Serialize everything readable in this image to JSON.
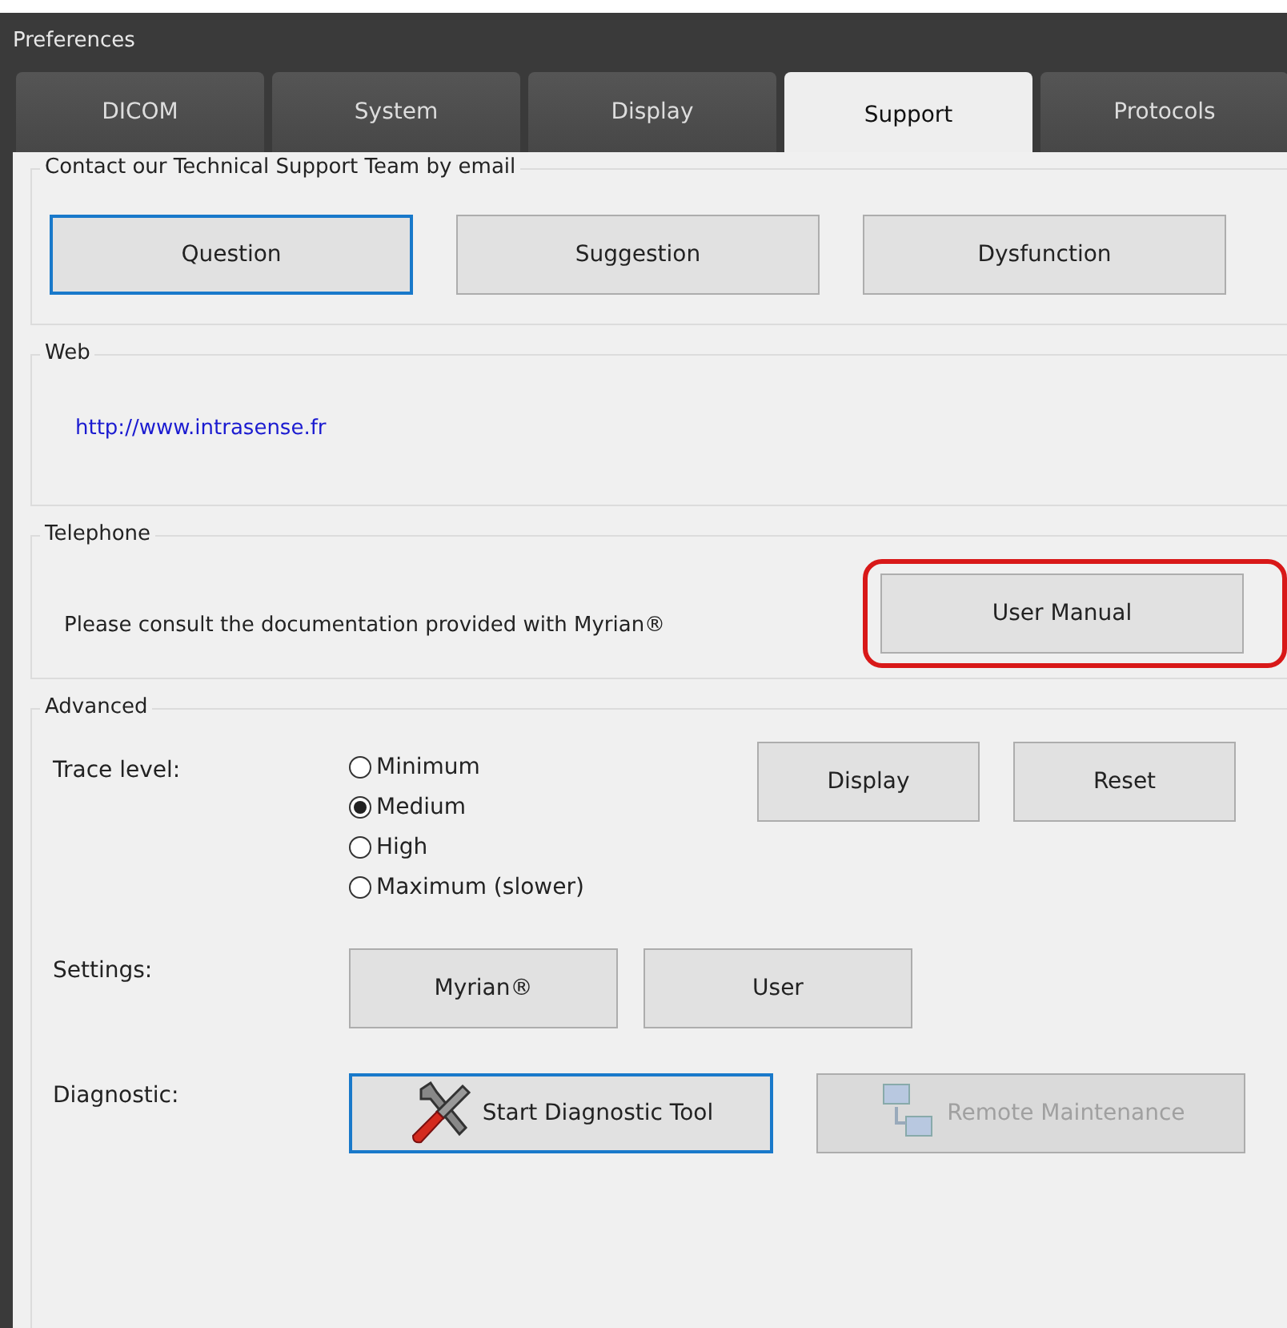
{
  "window": {
    "title": "Preferences"
  },
  "tabs": [
    {
      "label": "DICOM",
      "selected": false
    },
    {
      "label": "System",
      "selected": false
    },
    {
      "label": "Display",
      "selected": false
    },
    {
      "label": "Support",
      "selected": true
    },
    {
      "label": "Protocols",
      "selected": false
    }
  ],
  "contact": {
    "legend": "Contact our Technical Support Team by email",
    "buttons": [
      {
        "label": "Question",
        "focused": true
      },
      {
        "label": "Suggestion",
        "focused": false
      },
      {
        "label": "Dysfunction",
        "focused": false
      }
    ]
  },
  "web": {
    "legend": "Web",
    "link": "http://www.intrasense.fr"
  },
  "telephone": {
    "legend": "Telephone",
    "text": "Please consult the documentation provided with Myrian®",
    "button": {
      "label": "User Manual",
      "highlighted": true
    }
  },
  "advanced": {
    "legend": "Advanced",
    "trace_level": {
      "label": "Trace level:",
      "options": [
        {
          "label": "Minimum",
          "selected": false
        },
        {
          "label": "Medium",
          "selected": true
        },
        {
          "label": "High",
          "selected": false
        },
        {
          "label": "Maximum (slower)",
          "selected": false
        }
      ],
      "buttons": [
        {
          "label": "Display"
        },
        {
          "label": "Reset"
        }
      ]
    },
    "settings": {
      "label": "Settings:",
      "buttons": [
        {
          "label": "Myrian®"
        },
        {
          "label": "User"
        }
      ]
    },
    "diagnostic": {
      "label": "Diagnostic:",
      "buttons": [
        {
          "label": "Start Diagnostic Tool",
          "kind": "tools",
          "focused": true,
          "disabled": false
        },
        {
          "label": "Remote Maintenance",
          "kind": "network",
          "focused": false,
          "disabled": true
        }
      ]
    }
  }
}
